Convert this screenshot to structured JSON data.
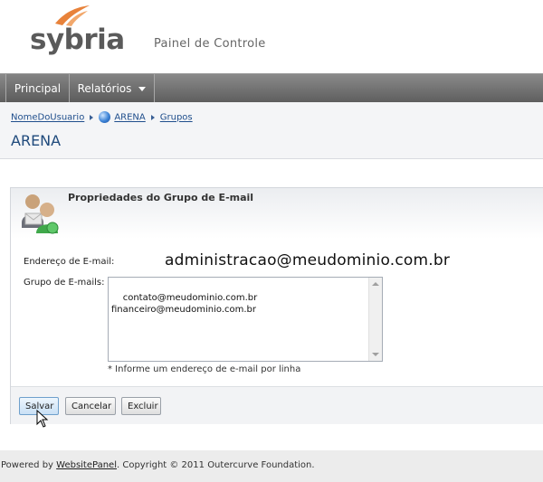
{
  "header": {
    "logo_text": "sybria",
    "panel_title": "Painel de Controle"
  },
  "nav": {
    "items": [
      {
        "label": "Principal"
      },
      {
        "label": "Relatórios"
      }
    ]
  },
  "breadcrumb": {
    "items": [
      "NomeDoUsuario",
      "ARENA",
      "Grupos"
    ]
  },
  "page": {
    "title": "ARENA"
  },
  "form": {
    "section_title": "Propriedades do Grupo de E-mail",
    "email_label": "Endereço de E-mail:",
    "email_value": "administracao@meudominio.com.br",
    "group_label": "Grupo de E-mails:",
    "group_emails": "contato@meudominio.com.br\nfinanceiro@meudominio.com.br",
    "hint": "* Informe um endereço de e-mail por linha"
  },
  "buttons": {
    "save": "Salvar",
    "cancel": "Cancelar",
    "delete": "Excluir"
  },
  "footer": {
    "prefix": "Powered by ",
    "link": "WebsitePanel",
    "suffix": ". Copyright © 2011 Outercurve Foundation."
  },
  "colors": {
    "accent_orange": "#e8823a",
    "heading_blue": "#1f4a7c",
    "link_blue": "#1f4e8c"
  }
}
